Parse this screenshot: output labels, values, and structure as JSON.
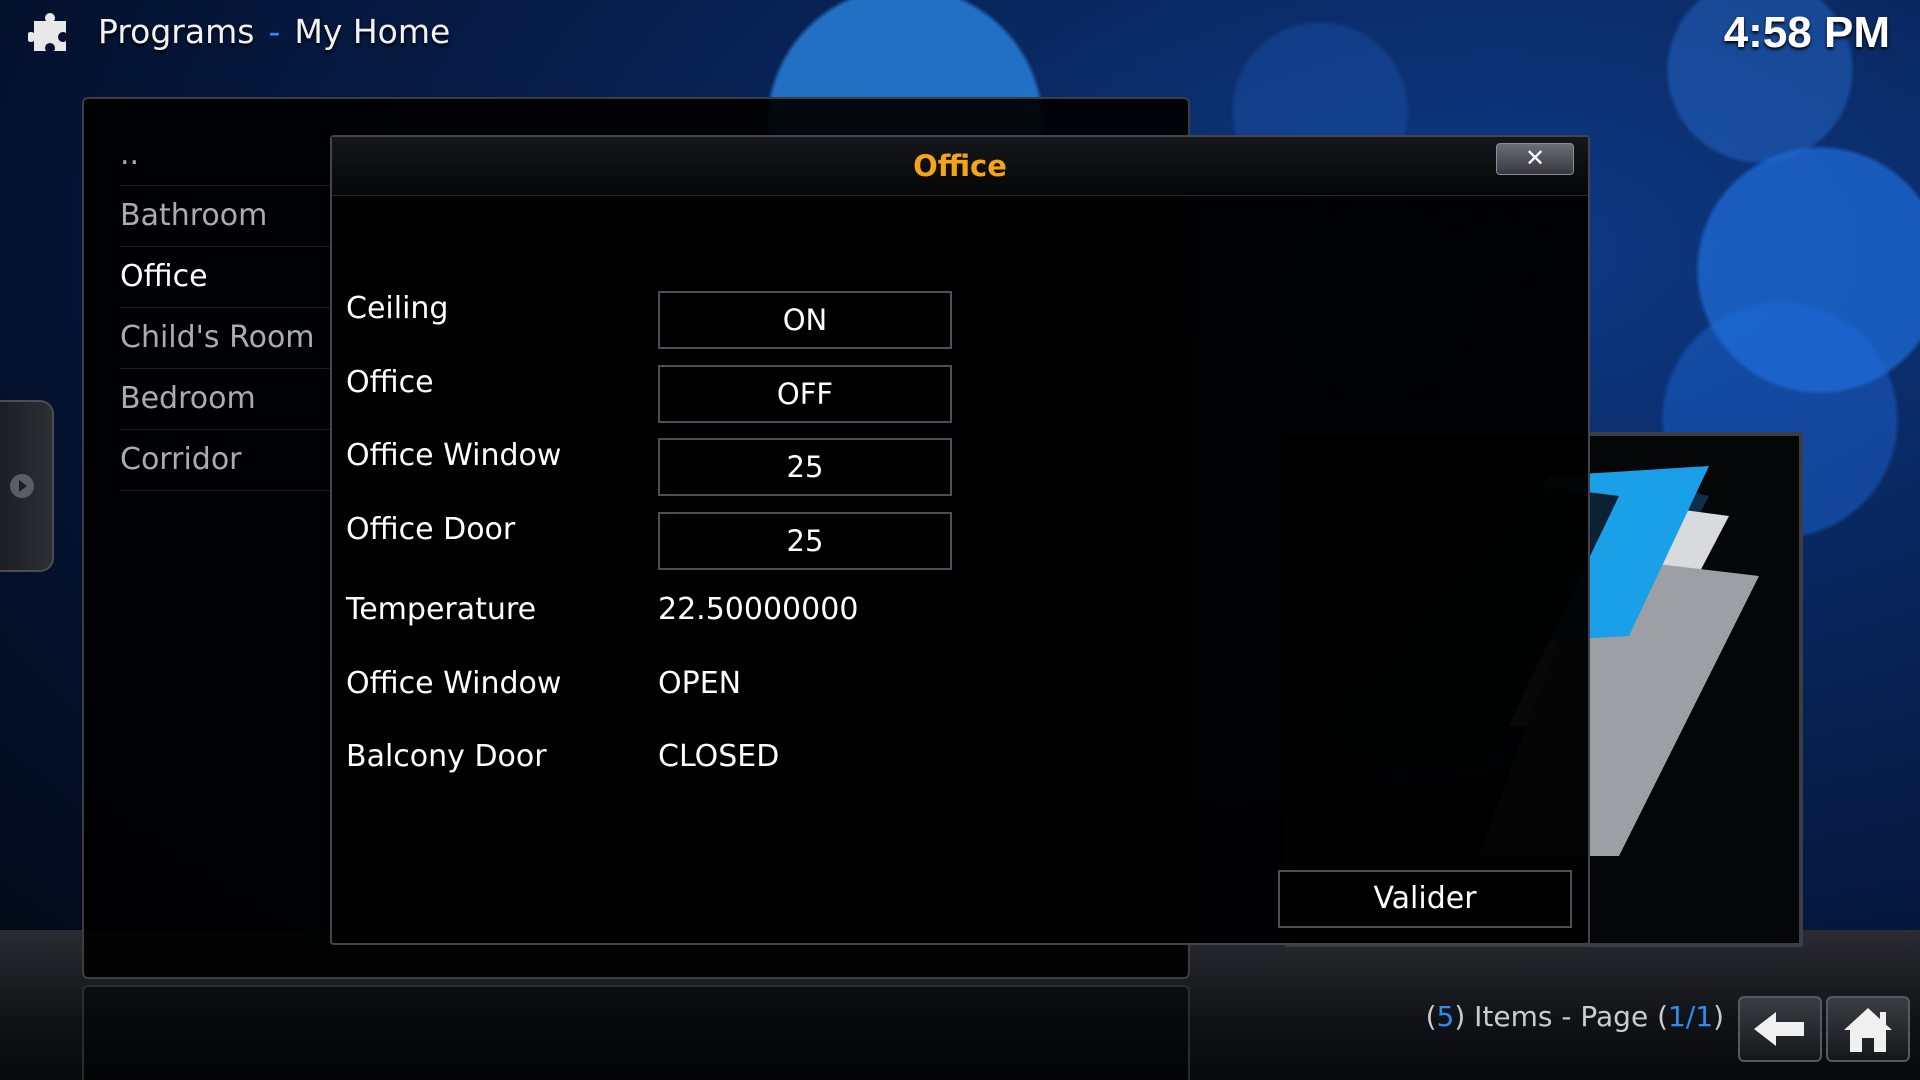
{
  "header": {
    "section": "Programs",
    "separator": "-",
    "title": "My Home",
    "clock": "4:58 PM"
  },
  "sidebar": {
    "items": [
      {
        "label": ".."
      },
      {
        "label": "Bathroom"
      },
      {
        "label": "Office"
      },
      {
        "label": "Child's Room"
      },
      {
        "label": "Bedroom"
      },
      {
        "label": "Corridor"
      }
    ],
    "selected": "Office"
  },
  "dialog": {
    "title": "Office",
    "close_label": "✕",
    "rows": [
      {
        "label": "Ceiling",
        "value": "ON"
      },
      {
        "label": "Office",
        "value": "OFF"
      },
      {
        "label": "Office Window",
        "value": "25"
      },
      {
        "label": "Office Door",
        "value": "25"
      },
      {
        "label": "Temperature",
        "value": "22.50000000"
      },
      {
        "label": "Office Window",
        "value": "OPEN"
      },
      {
        "label": "Balcony Door",
        "value": "CLOSED"
      }
    ],
    "validate_label": "Valider"
  },
  "footer": {
    "count_open": "(",
    "count": "5",
    "count_close": ") Items - Page (",
    "page": "1/1",
    "page_close": ")"
  },
  "colors": {
    "accent": "#2d8cf0",
    "title": "#f5a418"
  },
  "icons": {
    "header": "puzzle-icon",
    "back": "back-arrow-icon",
    "home": "home-icon"
  }
}
